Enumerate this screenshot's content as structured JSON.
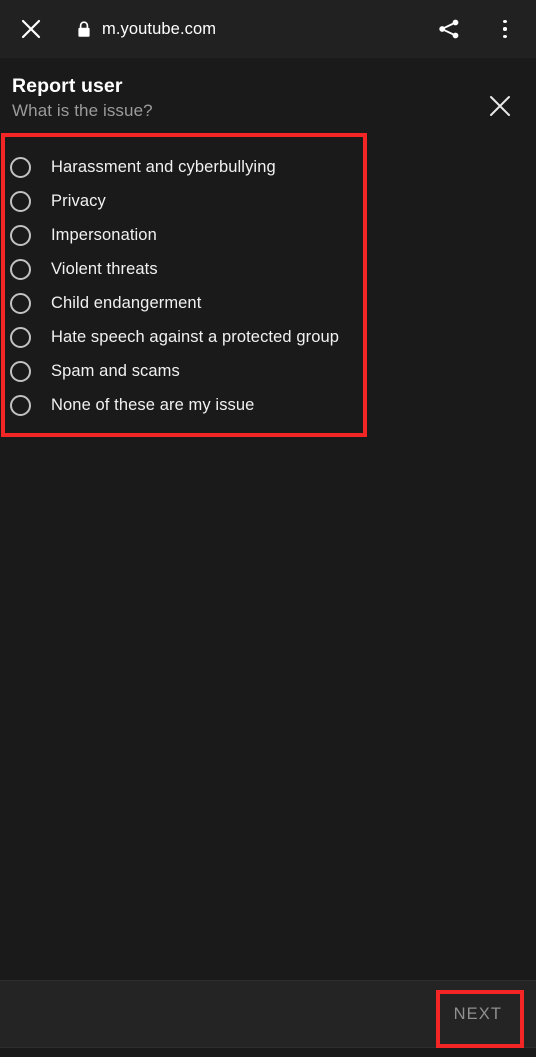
{
  "browser": {
    "close_icon": "close-icon",
    "lock_icon": "lock-icon",
    "url": "m.youtube.com",
    "share_icon": "share-icon",
    "overflow_icon": "more-vertical-icon"
  },
  "dialog": {
    "title": "Report user",
    "subtitle": "What is the issue?",
    "close_icon": "close-icon",
    "options": [
      {
        "label": "Harassment and cyberbullying",
        "selected": false
      },
      {
        "label": "Privacy",
        "selected": false
      },
      {
        "label": "Impersonation",
        "selected": false
      },
      {
        "label": "Violent threats",
        "selected": false
      },
      {
        "label": "Child endangerment",
        "selected": false
      },
      {
        "label": "Hate speech against a protected group",
        "selected": false
      },
      {
        "label": "Spam and scams",
        "selected": false
      },
      {
        "label": "None of these are my issue",
        "selected": false
      }
    ]
  },
  "footer": {
    "next_label": "NEXT"
  },
  "colors": {
    "page_background": "#1a1a1a",
    "chrome_background": "#212121",
    "footer_background": "#242424",
    "primary_text": "#ffffff",
    "secondary_text": "#9b9b9b",
    "option_text": "#f1f1f1",
    "disabled_text": "#909090",
    "annotation": "#f42525",
    "radio_outline": "#c2c2c2"
  }
}
